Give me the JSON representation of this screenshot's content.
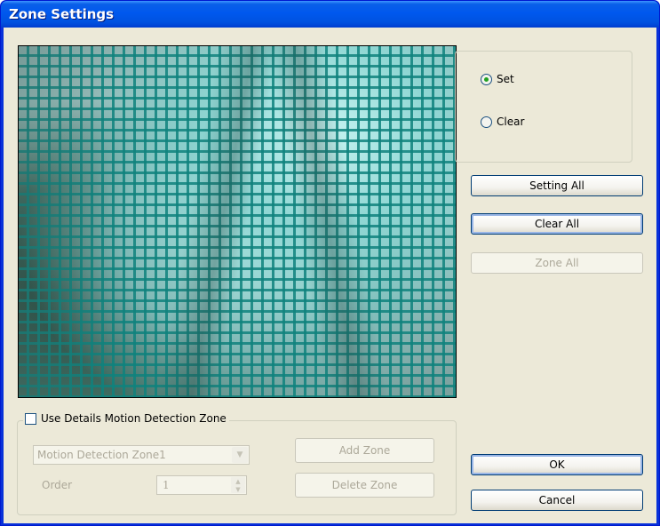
{
  "window": {
    "title": "Zone Settings"
  },
  "mode": {
    "options": [
      {
        "label": "Set",
        "selected": true
      },
      {
        "label": "Clear",
        "selected": false
      }
    ]
  },
  "buttons": {
    "setting_all": "Setting All",
    "clear_all": "Clear All",
    "zone_all": "Zone All",
    "ok": "OK",
    "cancel": "Cancel"
  },
  "details": {
    "checkbox_label": "Use Details Motion Detection Zone",
    "checked": false,
    "zone_select_value": "Motion Detection Zone1",
    "add_zone_label": "Add Zone",
    "delete_zone_label": "Delete Zone",
    "order_label": "Order",
    "order_value": "1"
  },
  "colors": {
    "titlebar": "#0058ee",
    "grid": "#0f827d",
    "dialog_bg": "#ece9d8",
    "disabled_text": "#aca899"
  }
}
